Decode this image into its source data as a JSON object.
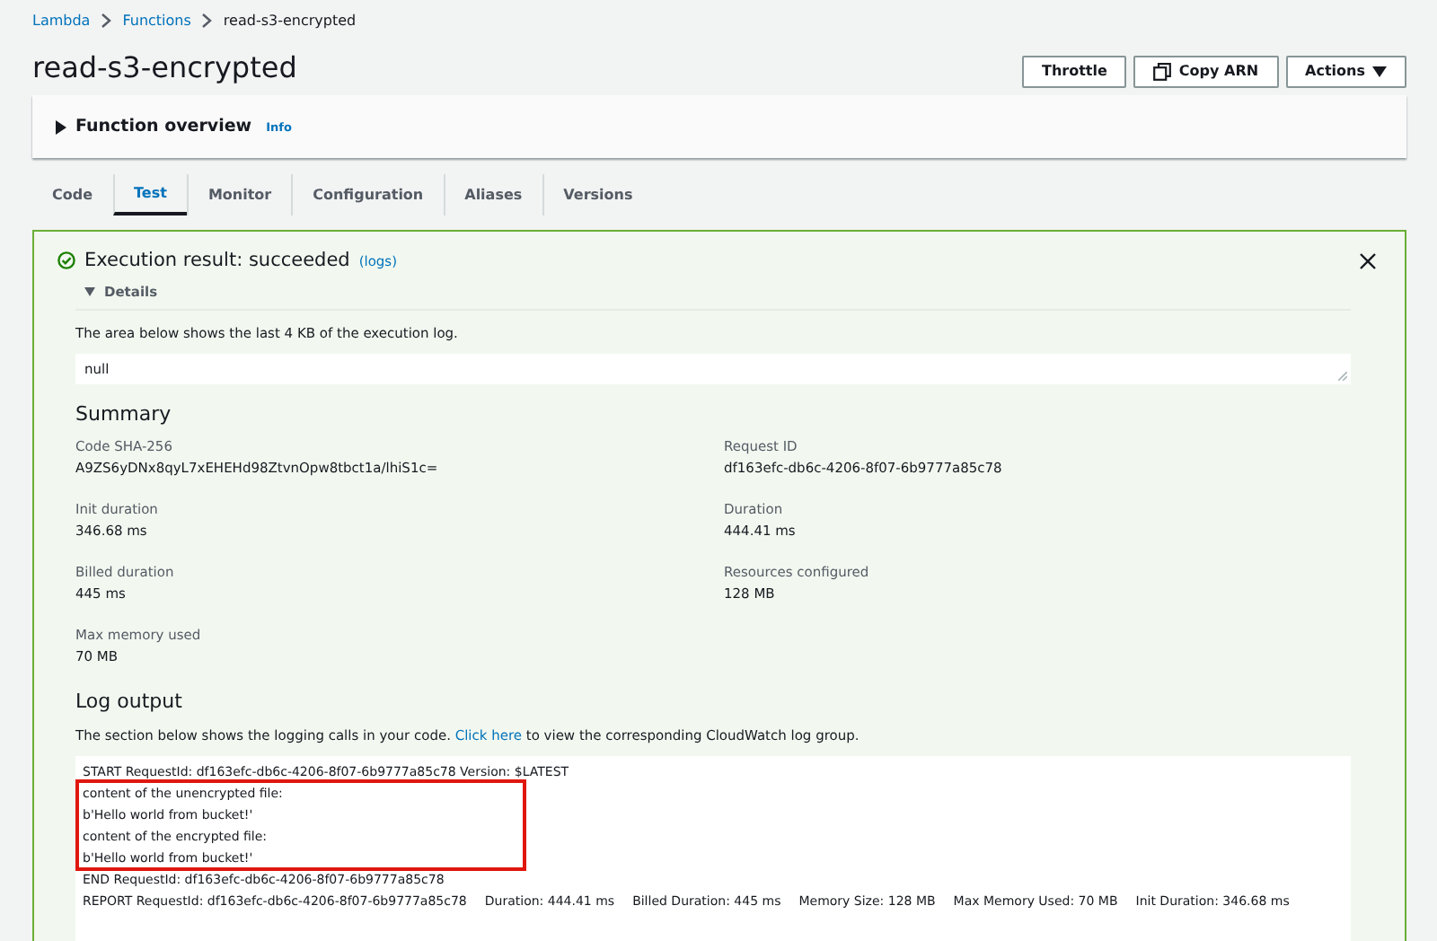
{
  "breadcrumbs": [
    {
      "label": "Lambda",
      "link": true
    },
    {
      "label": "Functions",
      "link": true
    },
    {
      "label": "read-s3-encrypted",
      "link": false
    }
  ],
  "title": "read-s3-encrypted",
  "header_buttons": [
    {
      "kind": "plain",
      "label": "Throttle"
    },
    {
      "kind": "copy",
      "label": "Copy ARN"
    },
    {
      "kind": "dropdown",
      "label": "Actions"
    }
  ],
  "overview": {
    "title": "Function overview",
    "info": "Info",
    "expanded": false
  },
  "tabs": [
    {
      "label": "Code",
      "selected": false
    },
    {
      "label": "Test",
      "selected": true
    },
    {
      "label": "Monitor",
      "selected": false
    },
    {
      "label": "Configuration",
      "selected": false
    },
    {
      "label": "Aliases",
      "selected": false
    },
    {
      "label": "Versions",
      "selected": false
    }
  ],
  "result": {
    "title": "Execution result: succeeded",
    "logs_link": "(logs)",
    "details": {
      "label": "Details",
      "expanded": true
    },
    "description": "The area below shows the last 4 KB of the execution log.",
    "output": "null",
    "summary_title": "Summary",
    "summary": [
      {
        "label": "Code SHA-256",
        "value": "A9ZS6yDNx8qyL7xEHEHd98ZtvnOpw8tbct1a/lhiS1c="
      },
      {
        "label": "Request ID",
        "value": "df163efc-db6c-4206-8f07-6b9777a85c78"
      },
      {
        "label": "Init duration",
        "value": "346.68 ms"
      },
      {
        "label": "Duration",
        "value": "444.41 ms"
      },
      {
        "label": "Billed duration",
        "value": "445 ms"
      },
      {
        "label": "Resources configured",
        "value": "128 MB"
      },
      {
        "label": "Max memory used",
        "value": "70 MB"
      }
    ],
    "log_title": "Log output",
    "log_description": {
      "before": "The section below shows the logging calls in your code.",
      "link": "Click here",
      "after": "to view the corresponding CloudWatch log group."
    },
    "log_lines": [
      {
        "kind": "line",
        "text": "START RequestId: df163efc-db6c-4206-8f07-6b9777a85c78 Version: $LATEST"
      },
      {
        "kind": "highlight",
        "lines": [
          "content of the unencrypted file:",
          "b'Hello world from bucket!'",
          "content of the encrypted file:",
          "b'Hello world from bucket!'"
        ]
      },
      {
        "kind": "line",
        "text": "END RequestId: df163efc-db6c-4206-8f07-6b9777a85c78"
      },
      {
        "kind": "line",
        "text": "REPORT RequestId: df163efc-db6c-4206-8f07-6b9777a85c78\tDuration: 444.41 ms\tBilled Duration: 445 ms\tMemory Size: 128 MB\tMax Memory Used: 70 MB\tInit Duration: 346.68 ms"
      }
    ]
  }
}
